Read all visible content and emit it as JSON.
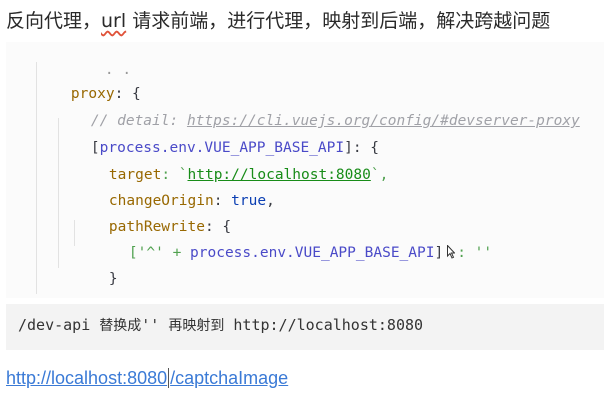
{
  "heading": {
    "before": "反向代理，",
    "url_word": "url",
    "after": " 请求前端，进行代理，映射到后端，解决跨越问题"
  },
  "code": {
    "partial_top": ". .",
    "line1_key": "proxy",
    "line1_rest": ": {",
    "comment_label": "// detail: ",
    "comment_url": "https://cli.vuejs.org/config/#devserver-proxy",
    "line3_open": "[",
    "line3_env": "process.env.VUE_APP_BASE_API",
    "line3_close": "]: {",
    "target_key": "target",
    "target_sep": ": `",
    "target_url": "http://localhost:8080",
    "target_end": "`,",
    "change_key": "changeOrigin",
    "change_sep": ": ",
    "change_val": "true",
    "change_end": ",",
    "rewrite_key": "pathRewrite",
    "rewrite_rest": ": {",
    "rewrite_str1": "['^' + ",
    "rewrite_env": "process.env.VUE_APP_BASE_API",
    "rewrite_bracket": "]",
    "rewrite_str2": ": ''",
    "close_inner": "}",
    "close_outer": "}"
  },
  "replace": {
    "path": "/dev-api ",
    "label1": "替换成",
    "quotes": "'' ",
    "label2": "再映射到",
    "url": " http://localhost:8080"
  },
  "link": {
    "host": "http://localhost:8080",
    "path": "/captchaImage"
  }
}
